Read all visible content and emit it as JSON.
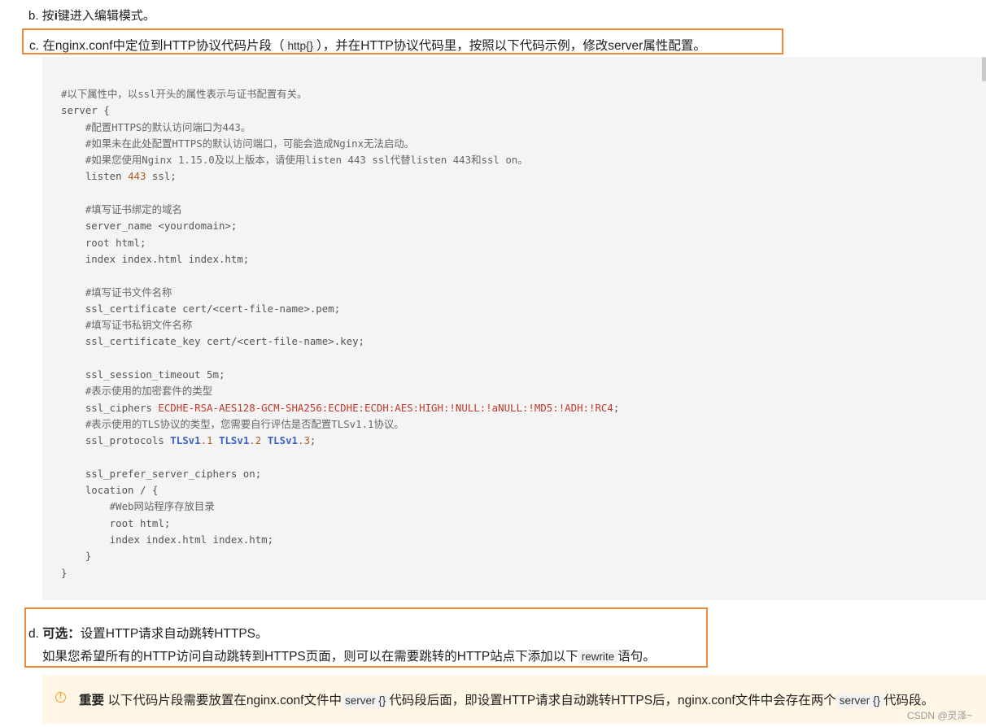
{
  "step_b": {
    "prefix": "b. 按",
    "key": "i",
    "suffix": "键进入编辑模式。"
  },
  "step_c": {
    "before": "c. 在nginx.conf中定位到HTTP协议代码片段（",
    "code": "http{}",
    "after": "），并在HTTP协议代码里，按照以下代码示例，修改server属性配置。"
  },
  "code_lines": [
    "#以下属性中，以ssl开头的属性表示与证书配置有关。",
    "server {",
    "    #配置HTTPS的默认访问端口为443。",
    "    #如果未在此处配置HTTPS的默认访问端口，可能会造成Nginx无法启动。",
    "    #如果您使用Nginx 1.15.0及以上版本，请使用listen 443 ssl代替listen 443和ssl on。",
    "    listen ",
    "    ",
    "    #填写证书绑定的域名",
    "    server_name <yourdomain>;",
    "    root html;",
    "    index index.html index.htm;",
    "    ",
    "    #填写证书文件名称",
    "    ssl_certificate cert/<cert-file-name>.pem;",
    "    #填写证书私钥文件名称",
    "    ssl_certificate_key cert/<cert-file-name>.key;",
    "    ",
    "    ssl_session_timeout 5m;",
    "    #表示使用的加密套件的类型",
    "    ssl_ciphers ",
    "    #表示使用的TLS协议的类型，您需要自行评估是否配置TLSv1.1协议。",
    "    ssl_protocols ",
    "    ",
    "    ssl_prefer_server_ciphers on;",
    "    location / {",
    "        #Web网站程序存放目录",
    "        root html;",
    "        index index.html index.htm;",
    "    }",
    "}"
  ],
  "code_tokens": {
    "listen_port": "443",
    "listen_tail": " ssl;",
    "ciphers_value": "ECDHE-RSA-AES128-GCM-SHA256:ECDHE:ECDH:AES:HIGH:!NULL:!aNULL:!MD5:!ADH:!RC4",
    "semicolon": ";",
    "tls_v": "TLSv1",
    "tls_1": ".1",
    "tls_2": ".2",
    "tls_3": ".3",
    "space": " "
  },
  "step_d": {
    "prefix": "d. ",
    "bold": "可选：",
    "title": "设置HTTP请求自动跳转HTTPS。",
    "desc_before": "如果您希望所有的HTTP访问自动跳转到HTTPS页面，则可以在需要跳转的HTTP站点下添加以下",
    "desc_code": "rewrite",
    "desc_after": "语句。"
  },
  "notice": {
    "icon": "!",
    "bold": "重要",
    "text_1": " 以下代码片段需要放置在nginx.conf文件中",
    "code_1": "server {}",
    "text_2": "代码段后面，即设置HTTP请求自动跳转HTTPS后，nginx.conf文件中会存在两个",
    "code_2": "server {}",
    "text_3": "代码段。"
  },
  "watermark": "CSDN @灵泽~",
  "colors": {
    "highlight_border": "#ef8a3b",
    "notice_bg": "#fff6e6",
    "code_bg": "#f4f4f4"
  }
}
